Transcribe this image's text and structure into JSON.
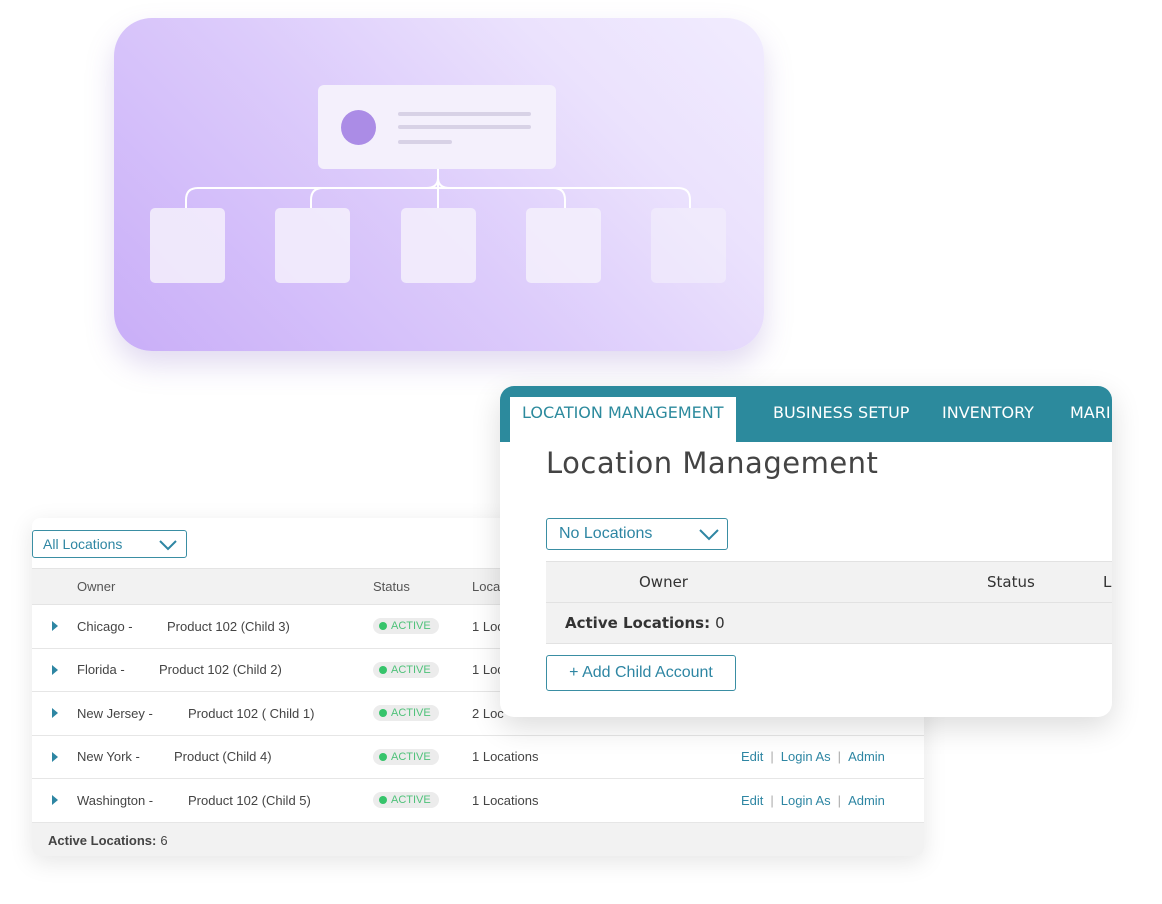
{
  "illustration": {
    "colors": {
      "card": "#c9aef8",
      "node": "#f4f0fc",
      "dot": "#ab8ce6"
    }
  },
  "back_panel": {
    "filter": {
      "selected": "All Locations"
    },
    "table": {
      "headers": {
        "owner": "Owner",
        "status": "Status",
        "locations": "Loca"
      },
      "rows": [
        {
          "city": "Chicago -",
          "product": "Product 102 (Child 3)",
          "status": "ACTIVE",
          "locations": "1 Loc",
          "edit": "",
          "login": "",
          "admin": ""
        },
        {
          "city": "Florida -",
          "product": "Product 102 (Child 2)",
          "status": "ACTIVE",
          "locations": "1 Loc",
          "edit": "",
          "login": "",
          "admin": ""
        },
        {
          "city": "New Jersey -",
          "product": "Product 102 ( Child 1)",
          "status": "ACTIVE",
          "locations": "2 Loc",
          "edit": "",
          "login": "",
          "admin": ""
        },
        {
          "city": "New York -",
          "product": "Product (Child 4)",
          "status": "ACTIVE",
          "locations": "1 Locations",
          "edit": "Edit",
          "login": "Login As",
          "admin": "Admin"
        },
        {
          "city": "Washington -",
          "product": "Product 102 (Child 5)",
          "status": "ACTIVE",
          "locations": "1 Locations",
          "edit": "Edit",
          "login": "Login As",
          "admin": "Admin"
        }
      ],
      "footer": {
        "label": "Active Locations:",
        "count": "6"
      }
    }
  },
  "front_panel": {
    "tabs": [
      "LOCATION MANAGEMENT",
      "BUSINESS SETUP",
      "INVENTORY",
      "MARI"
    ],
    "title": "Location Management",
    "filter": {
      "selected": "No Locations"
    },
    "table": {
      "headers": {
        "owner": "Owner",
        "status": "Status",
        "locations": "L"
      },
      "summary": {
        "label": "Active Locations:",
        "count": "0"
      }
    },
    "add_button": "+ Add Child Account"
  },
  "colors": {
    "teal": "#2c8a9d",
    "link": "#2e86a3",
    "active_green": "#36c46b"
  }
}
